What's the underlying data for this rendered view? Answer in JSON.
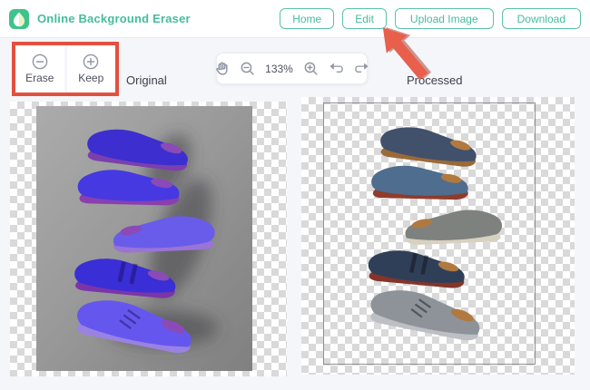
{
  "header": {
    "title": "Online Background Eraser",
    "logo_icon": "leaf-drop-logo",
    "nav": [
      {
        "label": "Home"
      },
      {
        "label": "Edit"
      },
      {
        "label": "Upload Image"
      },
      {
        "label": "Download"
      }
    ]
  },
  "tools": {
    "erase": {
      "label": "Erase",
      "icon": "minus-circle-icon"
    },
    "keep": {
      "label": "Keep",
      "icon": "plus-circle-icon"
    }
  },
  "panels": {
    "original_label": "Original",
    "processed_label": "Processed",
    "original_content": "stack of five dress shoes tinted purple (keep-selection overlay) on gray studio background",
    "processed_content": "same stack of five dress shoes in natural navy/gray/brown colors on transparent checkerboard"
  },
  "zoom_toolbar": {
    "zoom_level": "133%",
    "icons": [
      "pan-hand",
      "zoom-out",
      "zoom-in",
      "undo",
      "redo"
    ]
  },
  "annotations": {
    "highlight_box_target": "Erase and Keep tools",
    "arrow_target": "Edit button"
  },
  "colors": {
    "accent_teal": "#45bd9c",
    "highlight_red": "#e4503e",
    "arrow_red": "#e8604c",
    "page_background": "#f4f6fa",
    "checker_gray": "#d9d9d9"
  }
}
